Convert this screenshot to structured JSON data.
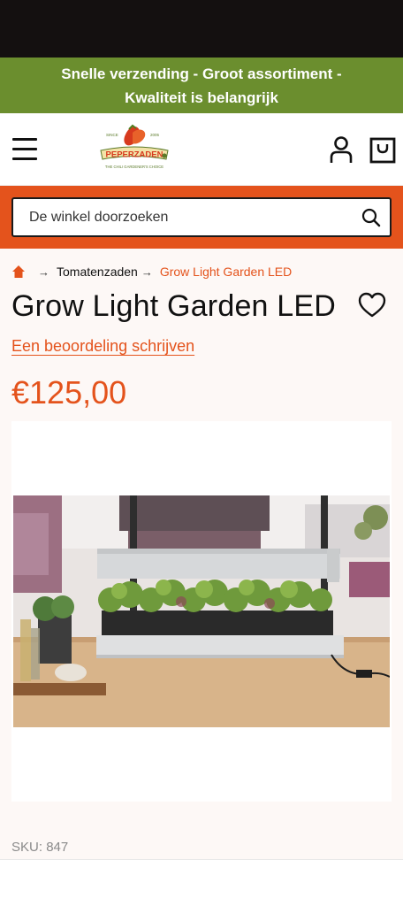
{
  "promo": {
    "line1": "Snelle verzending - Groot assortiment -",
    "line2": "Kwaliteit is belangrijk"
  },
  "header": {
    "logo": {
      "brand": "PEPERZADEN",
      "since": "SINCE",
      "year": "2005",
      "tagline": "THE CHILI GARDENER'S CHOICE"
    },
    "icons": [
      "menu-icon",
      "user-icon",
      "shopping-bag-icon"
    ]
  },
  "search": {
    "placeholder": "De winkel doorzoeken",
    "icon": "search-icon"
  },
  "breadcrumb": {
    "home_icon": "home-icon",
    "items": [
      "Tomatenzaden",
      "Grow Light Garden LED"
    ]
  },
  "product": {
    "title": "Grow Light Garden LED",
    "review_link": "Een beoordeling schrijven",
    "price": "€125,00",
    "sku_label": "SKU:",
    "sku_value": "847"
  },
  "colors": {
    "accent": "#e4531c",
    "promo_green": "#6b8e2e",
    "status_bar": "#141010"
  }
}
